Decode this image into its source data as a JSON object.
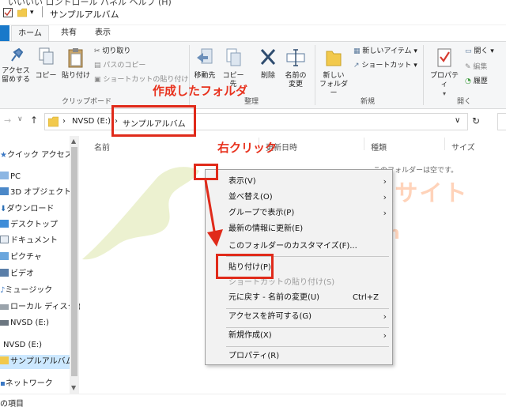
{
  "window": {
    "title": "サンプルアルバム",
    "top_cut_text": "いいいい ロントロール パネル  ヘルプ (H)"
  },
  "tabs": {
    "file": "",
    "home": "ホーム",
    "share": "共有",
    "view": "表示"
  },
  "ribbon": {
    "access": "アクセス",
    "pin_sub": "留めする",
    "copy": "コピー",
    "paste": "貼り付け",
    "cut": "切り取り",
    "copy_path": "パスのコピー",
    "paste_shortcut": "ショートカットの貼り付け",
    "clipboard_group": "クリップボード",
    "move_to": "移動先",
    "copy_to": "コピー先",
    "delete": "削除",
    "rename_1": "名前の",
    "rename_2": "変更",
    "organize_group": "整理",
    "new_folder_1": "新しい",
    "new_folder_2": "フォルダー",
    "new_item": "新しいアイテム",
    "shortcut": "ショートカット",
    "new_group": "新規",
    "properties": "プロパティ",
    "open": "開く",
    "edit": "編集",
    "history": "履歴",
    "open_group": "開く"
  },
  "address": {
    "drive": "NVSD (E:)",
    "folder": "サンプルアルバム"
  },
  "nav": {
    "items": [
      {
        "label": "クイック アクセス"
      },
      {
        "label": "PC"
      },
      {
        "label": "3D オブジェクト"
      },
      {
        "label": "ダウンロード"
      },
      {
        "label": "デスクトップ"
      },
      {
        "label": "ドキュメント"
      },
      {
        "label": "ピクチャ"
      },
      {
        "label": "ビデオ"
      },
      {
        "label": "ミュージック"
      },
      {
        "label": "ローカル ディスク (C"
      },
      {
        "label": "NVSD (E:)"
      },
      {
        "label": "NVSD (E:)"
      },
      {
        "label": "サンプルアルバム"
      },
      {
        "label": "ネットワーク"
      }
    ],
    "status_items": "の項目"
  },
  "columns": {
    "name": "名前",
    "date": "更新日時",
    "type": "種類",
    "size": "サイズ"
  },
  "empty_message": "このフォルダーは空です。",
  "context_menu": [
    {
      "label": "表示(V)",
      "shortcut": "",
      "submenu": true,
      "disabled": false
    },
    {
      "label": "並べ替え(O)",
      "shortcut": "",
      "submenu": true,
      "disabled": false
    },
    {
      "label": "グループで表示(P)",
      "shortcut": "",
      "submenu": true,
      "disabled": false
    },
    {
      "label": "最新の情報に更新(E)",
      "shortcut": "",
      "submenu": false,
      "disabled": false
    },
    {
      "label": "このフォルダーのカスタマイズ(F)...",
      "shortcut": "",
      "submenu": false,
      "disabled": false
    },
    {
      "label": "貼り付け(P)",
      "shortcut": "",
      "submenu": false,
      "disabled": false
    },
    {
      "label": "ショートカットの貼り付け(S)",
      "shortcut": "",
      "submenu": false,
      "disabled": true
    },
    {
      "label": "元に戻す - 名前の変更(U)",
      "shortcut": "Ctrl+Z",
      "submenu": false,
      "disabled": false
    },
    {
      "label": "アクセスを許可する(G)",
      "shortcut": "",
      "submenu": true,
      "disabled": false
    },
    {
      "label": "新規作成(X)",
      "shortcut": "",
      "submenu": true,
      "disabled": false
    },
    {
      "label": "プロパティ(R)",
      "shortcut": "",
      "submenu": false,
      "disabled": false
    }
  ],
  "annotations": {
    "created_folder": "作成したフォルダ",
    "right_click": "右クリック",
    "color": "#e8321e"
  },
  "watermark": {
    "logo": "北陸くるま情報サイト",
    "url": "hokurikucar.com"
  },
  "colors": {
    "accent": "#1979ca",
    "selection": "#cce8ff",
    "ribbon_bg": "#f5f6f7"
  }
}
